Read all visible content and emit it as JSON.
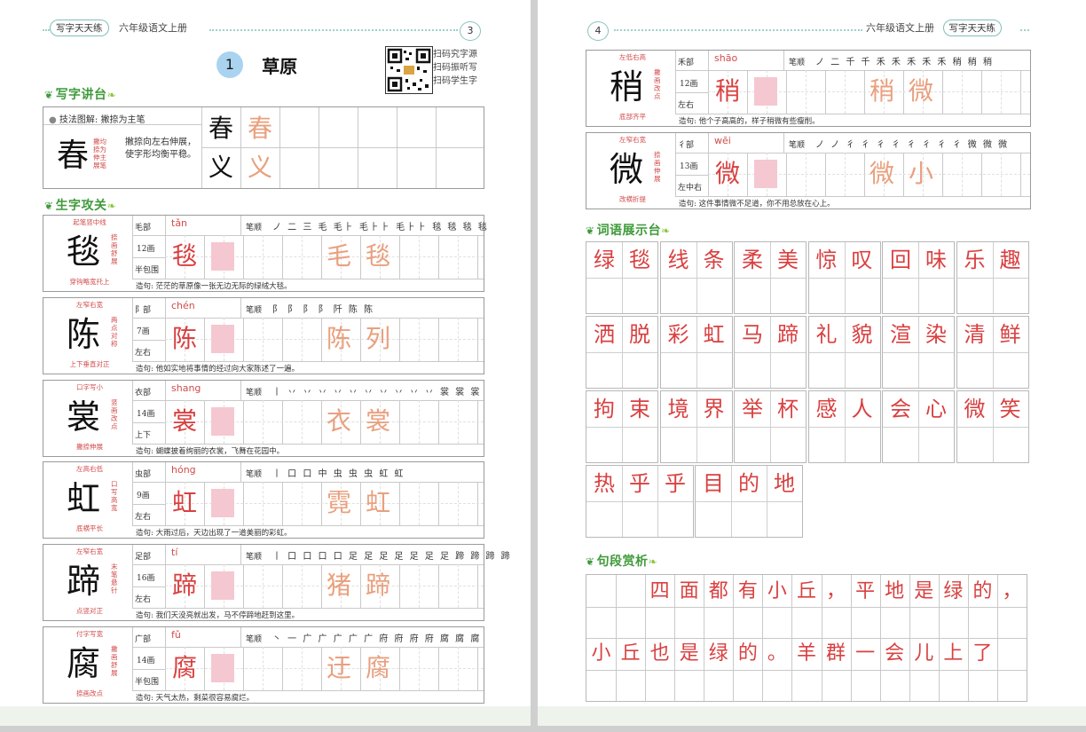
{
  "left_page": {
    "header": {
      "chip": "写字天天练",
      "grade": "六年级语文上册",
      "page_number": "3"
    },
    "lesson": {
      "number": "1",
      "title": "草原"
    },
    "qr_lines": [
      "扫码究字源",
      "扫码振听写",
      "扫码学生字"
    ],
    "section_titles": {
      "writing": "写字讲台",
      "characters": "生字攻关"
    },
    "technique": {
      "label": "技法图解: 撇捺为主笔",
      "char": "春",
      "notes": [
        "撇均",
        "捺为",
        "伸主",
        "展笔"
      ],
      "desc": "撇捺向左右伸展，使字形均衡平稳。",
      "examples": [
        [
          "春",
          "春"
        ],
        [
          "义",
          "义"
        ]
      ]
    },
    "characters": [
      {
        "char": "毯",
        "pinyin": "tǎn",
        "radical": "毛部",
        "strokes_count": "12画",
        "structure": "半包围",
        "stroke_order": "ノ 二 三 毛 毛⺊ 毛⺊⺊ 毛⺊⺊ 毯 毯 毯 毯",
        "words": [
          "毛",
          "毯"
        ],
        "sentence": "造句: 茫茫的草原像一张无边无际的绿绒大毯。",
        "top_note": "起笔竖中线",
        "side_note": "捺画舒展",
        "bottom_note": "穿钩略宽托上"
      },
      {
        "char": "陈",
        "pinyin": "chén",
        "radical": "阝部",
        "strokes_count": "7画",
        "structure": "左右",
        "stroke_order": "阝 阝 阝 阝 阡 陈 陈",
        "words": [
          "陈",
          "列"
        ],
        "sentence": "造句: 他如实地将事情的经过向大家陈述了一遍。",
        "top_note": "左窄右宽",
        "side_note": "两点对称",
        "bottom_note": "上下垂直对正"
      },
      {
        "char": "裳",
        "pinyin": "shang",
        "radical": "衣部",
        "strokes_count": "14画",
        "structure": "上下",
        "stroke_order": "丨 丷 丷 丷 丷 丷 丷 丷 丷 丷 丷 裳 裳 裳",
        "words": [
          "衣",
          "裳"
        ],
        "sentence": "造句: 蝴蝶披着绚丽的衣裳，飞舞在花园中。",
        "top_note": "口字写小",
        "side_note": "竖画改点",
        "bottom_note": "撇捺伸展"
      },
      {
        "char": "虹",
        "pinyin": "hóng",
        "radical": "虫部",
        "strokes_count": "9画",
        "structure": "左右",
        "stroke_order": "丨 口 口 中 虫 虫 虫 虹 虹",
        "words": [
          "霓",
          "虹"
        ],
        "sentence": "造句: 大雨过后，天边出现了一道美丽的彩虹。",
        "top_note": "左高右低",
        "side_note": "口写高宽",
        "bottom_note": "底横平长"
      },
      {
        "char": "蹄",
        "pinyin": "tí",
        "radical": "足部",
        "strokes_count": "16画",
        "structure": "左右",
        "stroke_order": "丨 口 口 口 口 足 足 足 足 足 足 足 蹄 蹄 蹄 蹄",
        "words": [
          "猪",
          "蹄"
        ],
        "sentence": "造句: 我们天没亮就出发，马不停蹄地赶到这里。",
        "top_note": "左窄右宽",
        "side_note": "末笔悬针",
        "bottom_note": "点竖对正"
      },
      {
        "char": "腐",
        "pinyin": "fǔ",
        "radical": "广部",
        "strokes_count": "14画",
        "structure": "半包围",
        "stroke_order": "丶 一 广 广 广 广 广 府 府 府 府 腐 腐 腐",
        "words": [
          "迂",
          "腐"
        ],
        "sentence": "造句: 天气太热，剩菜很容易腐烂。",
        "top_note": "付字写宽",
        "side_note": "撇画舒展",
        "bottom_note": "捺画改点"
      }
    ]
  },
  "right_page": {
    "header": {
      "chip": "写字天天练",
      "grade": "六年级语文上册",
      "page_number": "4"
    },
    "characters": [
      {
        "char": "稍",
        "pinyin": "shāo",
        "radical": "禾部",
        "strokes_count": "12画",
        "structure": "左右",
        "stroke_order": "ノ 二 千 千 禾 禾 禾 禾 禾 稍 稍 稍",
        "words": [
          "稍",
          "微"
        ],
        "sentence": "造句: 他个子高高的，样子稍微有些瘦削。",
        "top_note": "左低右高",
        "side_note": "撇画改点",
        "bottom_note": "底部齐平"
      },
      {
        "char": "微",
        "pinyin": "wēi",
        "radical": "彳部",
        "strokes_count": "13画",
        "structure": "左中右",
        "stroke_order": "ノ ノ 彳 彳 彳 彳 彳 彳 彳 彳 微 微 微",
        "words": [
          "微",
          "小"
        ],
        "sentence": "造句: 这件事情微不足道，你不用总放在心上。",
        "top_note": "左窄右宽",
        "side_note": "捺画伸展",
        "bottom_note": "改横折提"
      }
    ],
    "section_titles": {
      "words": "词语展示台",
      "passage": "句段赏析"
    },
    "word_groups": [
      [
        "绿",
        "毯"
      ],
      [
        "线",
        "条"
      ],
      [
        "柔",
        "美"
      ],
      [
        "惊",
        "叹"
      ],
      [
        "回",
        "味"
      ],
      [
        "乐",
        "趣"
      ],
      [
        "洒",
        "脱"
      ],
      [
        "彩",
        "虹"
      ],
      [
        "马",
        "蹄"
      ],
      [
        "礼",
        "貌"
      ],
      [
        "渲",
        "染"
      ],
      [
        "清",
        "鲜"
      ],
      [
        "拘",
        "束"
      ],
      [
        "境",
        "界"
      ],
      [
        "举",
        "杯"
      ],
      [
        "感",
        "人"
      ],
      [
        "会",
        "心"
      ],
      [
        "微",
        "笑"
      ],
      [
        "热",
        "乎",
        "乎"
      ],
      [
        "目",
        "的",
        "地"
      ]
    ],
    "passage_lines": [
      [
        "",
        "",
        "四",
        "面",
        "都",
        "有",
        "小",
        "丘",
        "，",
        "平",
        "地",
        "是",
        "绿",
        "的",
        "，"
      ],
      [
        "小",
        "丘",
        "也",
        "是",
        "绿",
        "的",
        "。",
        "羊",
        "群",
        "一",
        "会",
        "儿",
        "上",
        "了",
        ""
      ]
    ]
  }
}
